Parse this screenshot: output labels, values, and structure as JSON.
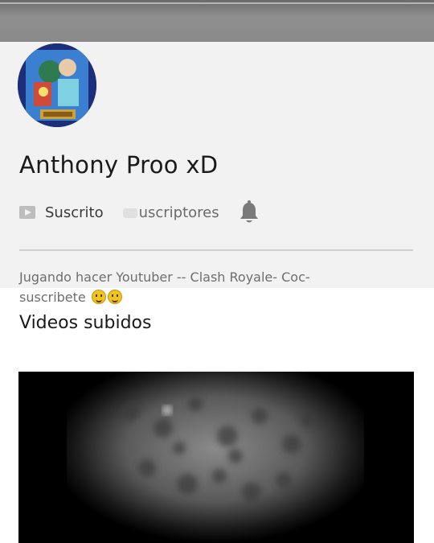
{
  "channel": {
    "name": "Anthony Proo xD",
    "subscribe_label": "Suscrito",
    "subscribers_label": "uscriptores",
    "description_line1": "Jugando hacer Youtuber -- Clash Royale- Coc-",
    "description_line2": "suscribete"
  },
  "icons": {
    "subscribe": "play-icon",
    "notifications": "bell-icon",
    "emoji": "smiling-face-emoji"
  },
  "sections": {
    "uploads_title": "Videos subidos"
  },
  "colors": {
    "header_bg": "#f2f2f2",
    "topbar": "#8a8a8a",
    "avatar_bg": "#1d2f7a",
    "emoji": "#f0c419"
  }
}
